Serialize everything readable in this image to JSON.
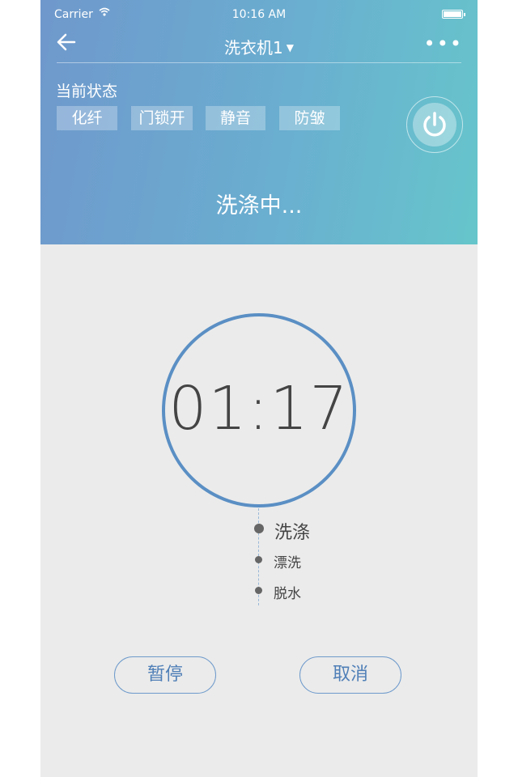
{
  "status_bar": {
    "carrier": "Carrier",
    "time": "10:16 AM"
  },
  "nav": {
    "title": "洗衣机1",
    "more": "•••"
  },
  "current_state": {
    "label": "当前状态",
    "tags": [
      "化纤",
      "门锁开",
      "静音",
      "防皱"
    ]
  },
  "status_text": "洗涤中...",
  "timer": "01:17",
  "steps": [
    {
      "label": "洗涤",
      "active": true
    },
    {
      "label": "漂洗",
      "active": false
    },
    {
      "label": "脱水",
      "active": false
    }
  ],
  "buttons": {
    "pause": "暂停",
    "cancel": "取消"
  },
  "colors": {
    "accent": "#5a8fc4",
    "header_start": "#6f98cc",
    "header_end": "#66c5cb"
  }
}
